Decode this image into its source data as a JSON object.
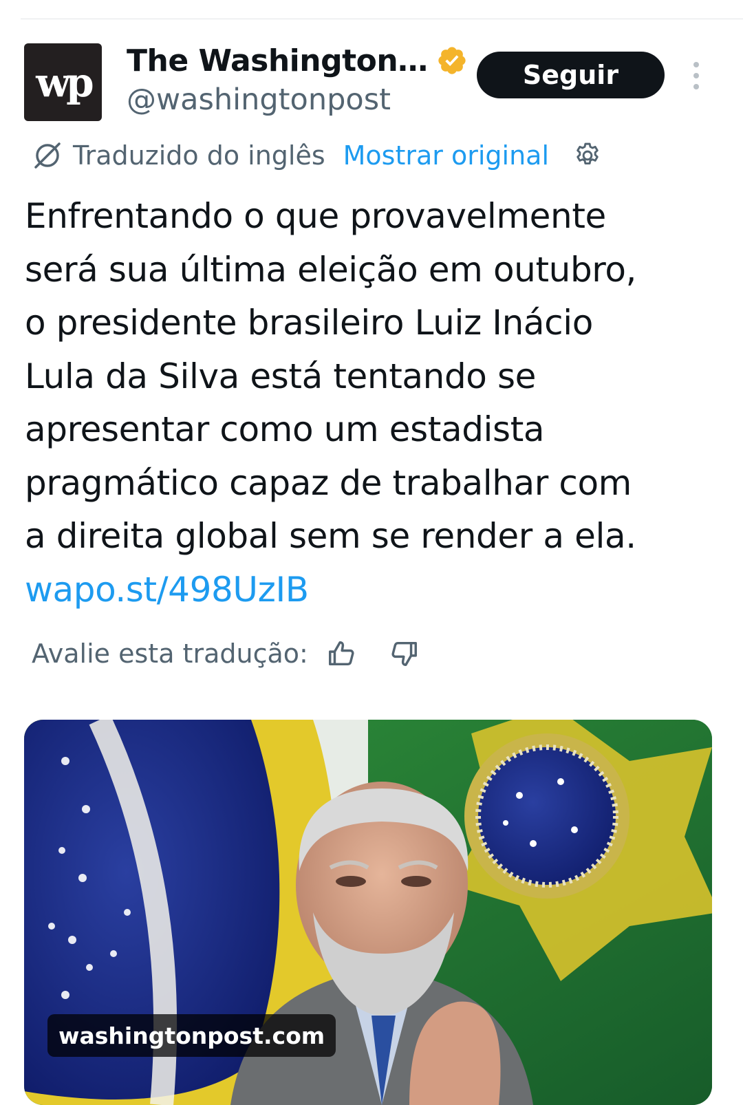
{
  "account": {
    "display_name": "The Washington…",
    "handle": "@washingtonpost",
    "avatar_text": "wp",
    "verified": true,
    "verified_color": "#f4b42b"
  },
  "actions": {
    "follow_label": "Seguir",
    "more_icon": "more-vertical-icon"
  },
  "translation": {
    "label": "Traduzido do inglês",
    "show_original": "Mostrar original",
    "settings_icon": "gear-icon"
  },
  "tweet": {
    "lines": [
      "Enfrentando o que provavelmente",
      "será sua última eleição em outubro,",
      "o presidente brasileiro Luiz Inácio",
      "Lula da Silva está tentando se",
      "apresentar como um estadista",
      "pragmático capaz de trabalhar com",
      "a direita global sem se render a ela."
    ],
    "link": "wapo.st/498UzIB"
  },
  "rating": {
    "label": "Avalie esta tradução:"
  },
  "media": {
    "domain": "washingtonpost.com"
  },
  "colors": {
    "link": "#1d9bf0",
    "secondary_text": "#536471",
    "primary_text": "#0f1419",
    "button_bg": "#0f1419"
  }
}
